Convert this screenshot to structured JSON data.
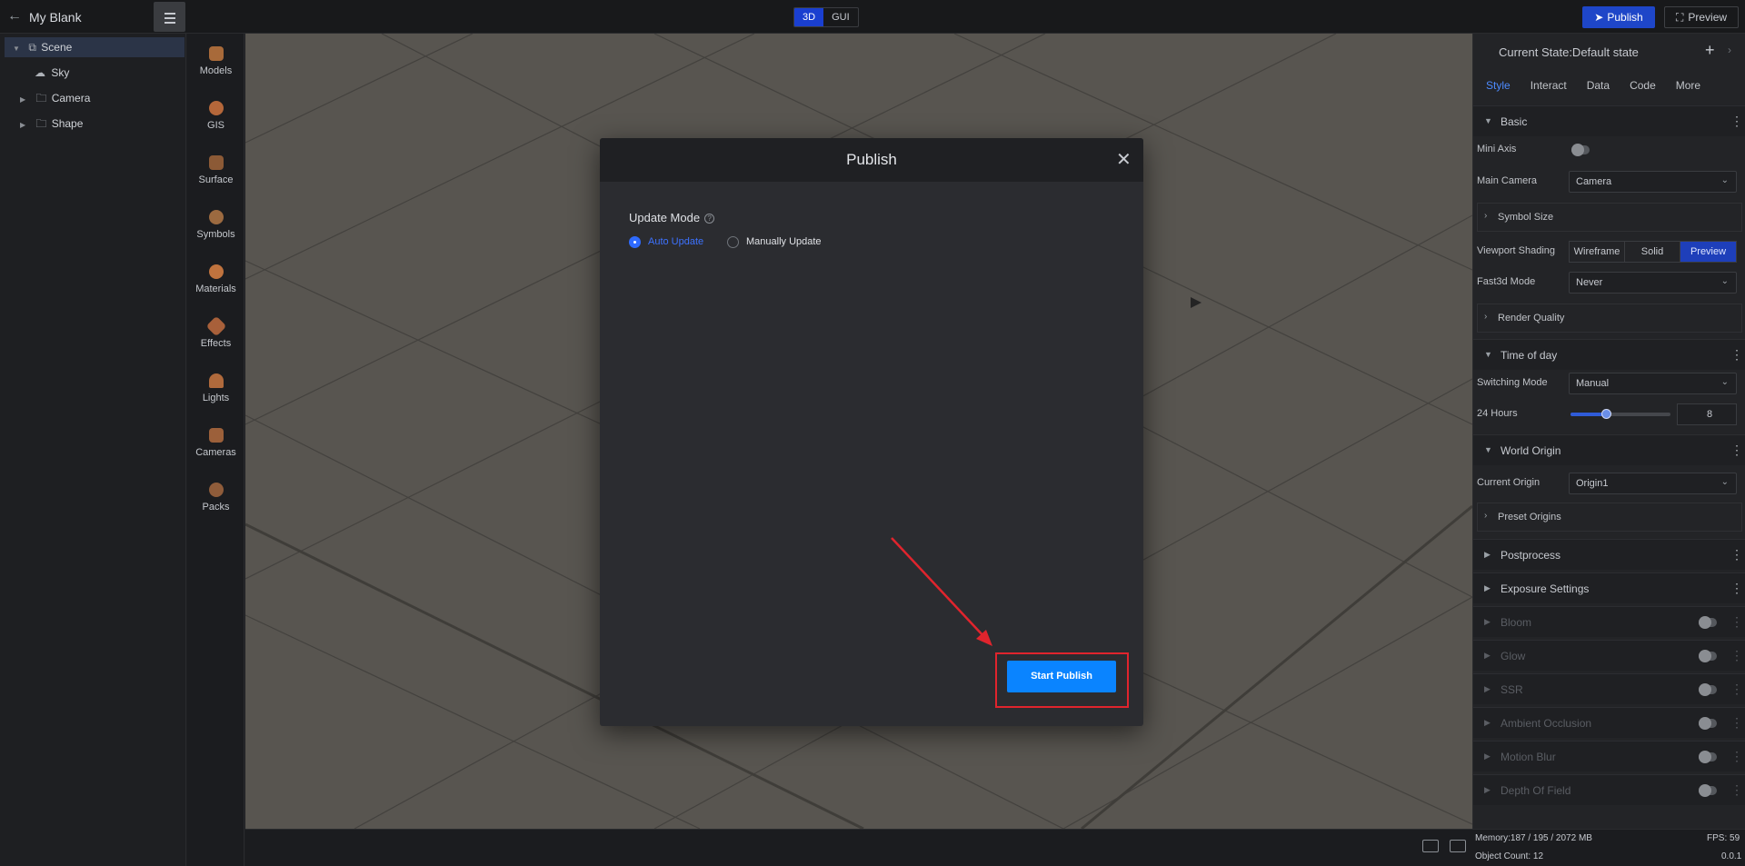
{
  "topbar": {
    "title": "My Blank",
    "mode_3d": "3D",
    "mode_gui": "GUI",
    "publish": "Publish",
    "preview": "Preview"
  },
  "tree": {
    "items": [
      {
        "label": "Scene"
      },
      {
        "label": "Sky"
      },
      {
        "label": "Camera"
      },
      {
        "label": "Shape"
      }
    ]
  },
  "toolbox": {
    "items": [
      {
        "label": "Models"
      },
      {
        "label": "GIS"
      },
      {
        "label": "Surface"
      },
      {
        "label": "Symbols"
      },
      {
        "label": "Materials"
      },
      {
        "label": "Effects"
      },
      {
        "label": "Lights"
      },
      {
        "label": "Cameras"
      },
      {
        "label": "Packs"
      }
    ]
  },
  "panel": {
    "state": "Current State:Default state",
    "tabs": [
      "Style",
      "Interact",
      "Data",
      "Code",
      "More"
    ],
    "basic": "Basic",
    "mini_axis": "Mini Axis",
    "main_camera": "Main Camera",
    "main_camera_value": "Camera",
    "symbol_size": "Symbol Size",
    "viewport_shading": "Viewport Shading",
    "shading_options": [
      "Wireframe",
      "Solid",
      "Preview"
    ],
    "fast3d_mode": "Fast3d Mode",
    "fast3d_value": "Never",
    "render_quality": "Render Quality",
    "time_of_day": "Time of day",
    "switching_mode": "Switching Mode",
    "switching_value": "Manual",
    "hours_label": "24 Hours",
    "hours_value": "8",
    "hours_fraction": 0.35,
    "world_origin": "World Origin",
    "current_origin": "Current Origin",
    "current_origin_value": "Origin1",
    "preset_origins": "Preset Origins",
    "postprocess": "Postprocess",
    "exposure": "Exposure Settings",
    "bloom": "Bloom",
    "glow": "Glow",
    "ssr": "SSR",
    "ao": "Ambient Occlusion",
    "motion_blur": "Motion Blur",
    "dof": "Depth Of Field"
  },
  "status": {
    "memory": "Memory:187 / 195 / 2072 MB",
    "fps": "FPS: 59",
    "objects": "Object Count: 12",
    "version": "0.0.1"
  },
  "modal": {
    "title": "Publish",
    "update_mode_label": "Update Mode",
    "auto_update": "Auto Update",
    "manual_update": "Manually Update",
    "start_publish": "Start Publish"
  },
  "colors": {
    "accent": "#0a84ff",
    "annotation": "#e0242d"
  }
}
